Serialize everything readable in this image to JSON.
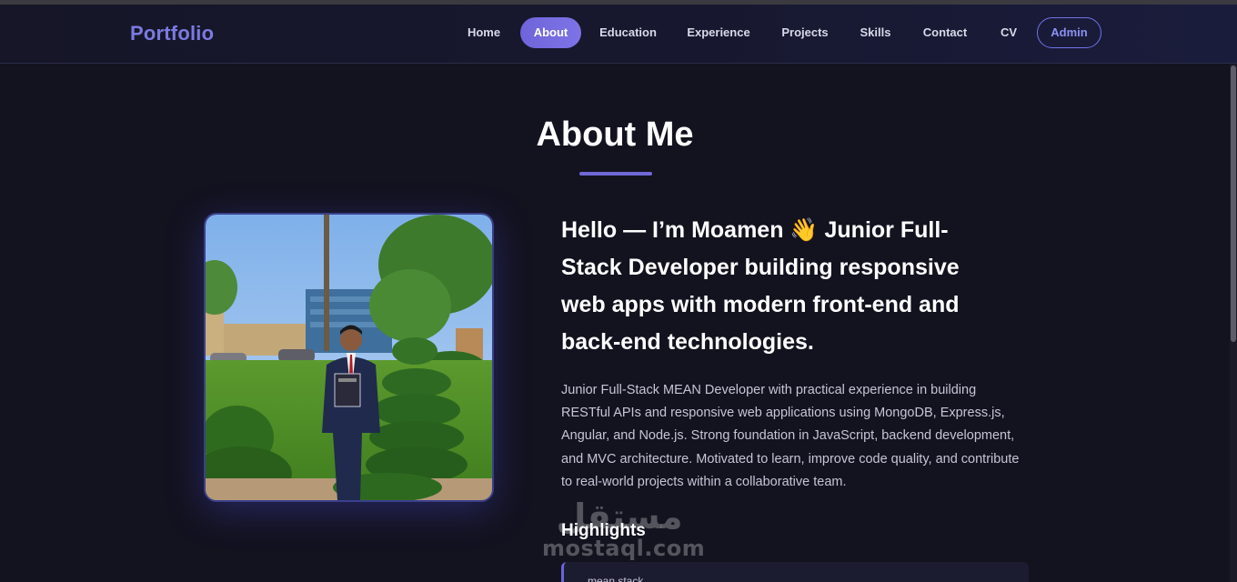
{
  "nav": {
    "logo": "Portfolio",
    "items": [
      {
        "label": "Home"
      },
      {
        "label": "About"
      },
      {
        "label": "Education"
      },
      {
        "label": "Experience"
      },
      {
        "label": "Projects"
      },
      {
        "label": "Skills"
      },
      {
        "label": "Contact"
      },
      {
        "label": "CV"
      },
      {
        "label": "Admin"
      }
    ],
    "active": "About"
  },
  "about": {
    "title": "About Me",
    "headline": "Hello — I’m Moamen 👋 Junior Full-Stack Developer building responsive web apps with modern front-end and back-end technologies.",
    "bio": "Junior Full-Stack MEAN Developer with practical experience in building RESTful APIs and responsive web applications using MongoDB, Express.js, Angular, and Node.js. Strong foundation in JavaScript, backend development, and MVC architecture. Motivated to learn, improve code quality, and contribute to real-world projects within a collaborative team.",
    "highlights_title": "Highlights",
    "highlight_first": "mean stack"
  },
  "watermark": {
    "arabic": "مستقل",
    "latin": "mostaql.com"
  },
  "colors": {
    "accent": "#7069d6",
    "background": "#13121f",
    "logo": "#7b7ae0"
  }
}
